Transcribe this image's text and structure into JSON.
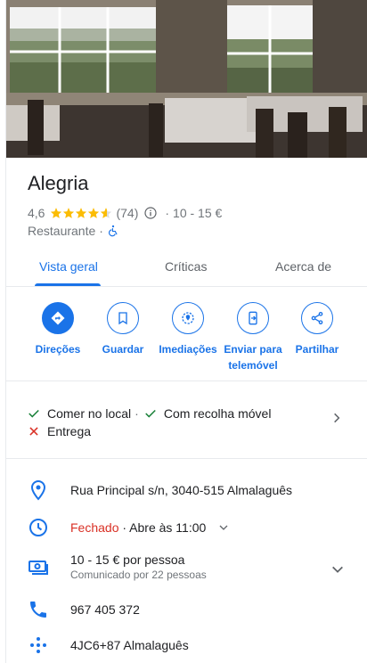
{
  "place": {
    "name": "Alegria",
    "rating": "4,6",
    "review_count": "(74)",
    "star_count": 4.6,
    "price_range": "10 - 15 €",
    "category": "Restaurante",
    "separator": "·"
  },
  "tabs": [
    {
      "label": "Vista geral",
      "active": true
    },
    {
      "label": "Críticas",
      "active": false
    },
    {
      "label": "Acerca de",
      "active": false
    }
  ],
  "actions": [
    {
      "label": "Direções",
      "icon": "directions-icon"
    },
    {
      "label": "Guardar",
      "icon": "bookmark-icon"
    },
    {
      "label": "Imediações",
      "icon": "nearby-icon"
    },
    {
      "label": "Enviar para telemóvel",
      "icon": "send-to-phone-icon"
    },
    {
      "label": "Partilhar",
      "icon": "share-icon"
    }
  ],
  "services": {
    "dine_in": "Comer no local",
    "takeaway": "Com recolha móvel",
    "delivery": "Entrega"
  },
  "details": {
    "address": "Rua Principal s/n, 3040-515 Almalaguês",
    "hours_status": "Fechado",
    "hours_next": "· Abre às 11:00",
    "price_per_person": "10 - 15 € por pessoa",
    "price_reported": "Comunicado por 22 pessoas",
    "phone": "967 405 372",
    "plus_code": "4JC6+87 Almalaguês"
  },
  "colors": {
    "accent": "#1a73e8",
    "star": "#fbbc04",
    "closed": "#d93025",
    "check": "#188038"
  }
}
